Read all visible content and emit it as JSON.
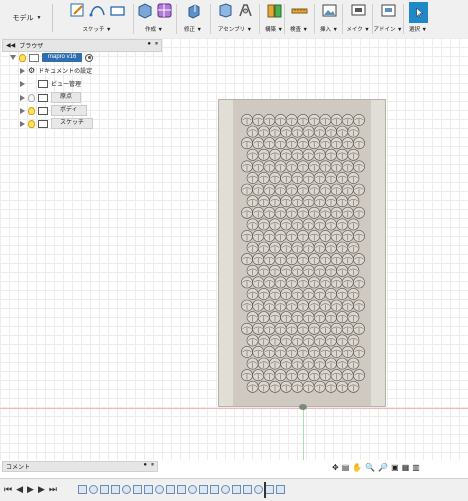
{
  "toolbar": {
    "workspace": "モデル",
    "groups": [
      {
        "label": "スケッチ ▼",
        "icons": [
          "sketch-create-icon",
          "arc-icon",
          "rectangle-icon"
        ]
      },
      {
        "label": "作成 ▼",
        "icons": [
          "box-icon",
          "sphere-mesh-icon"
        ]
      },
      {
        "label": "修正 ▼",
        "icons": [
          "press-pull-icon"
        ]
      },
      {
        "label": "アセンブリ ▼",
        "icons": [
          "new-component-icon",
          "joint-icon"
        ]
      },
      {
        "label": "構築 ▼",
        "icons": [
          "offset-plane-icon"
        ]
      },
      {
        "label": "検査 ▼",
        "icons": [
          "measure-icon"
        ]
      },
      {
        "label": "挿入 ▼",
        "icons": [
          "insert-image-icon"
        ]
      },
      {
        "label": "メイク ▼",
        "icons": [
          "make-3dprint-icon"
        ]
      },
      {
        "label": "アドイン ▼",
        "icons": [
          "addins-icon"
        ]
      },
      {
        "label": "選択 ▼",
        "icons": [
          "select-cursor-icon"
        ]
      }
    ]
  },
  "browser": {
    "title": "ブラウザ",
    "root": "mapro v16",
    "items": [
      {
        "label": "ドキュメントの設定",
        "icon": "gear-icon"
      },
      {
        "label": "ビュー管理",
        "icon": "folder-icon"
      },
      {
        "label": "原点",
        "icon": "folder-icon"
      },
      {
        "label": "ボディ",
        "icon": "folder-icon"
      },
      {
        "label": "スケッチ",
        "icon": "folder-icon"
      }
    ]
  },
  "comment": {
    "label": "コメント"
  },
  "navbar": {
    "icons": [
      "orbit-icon",
      "pan-icon",
      "look-at-icon",
      "zoom-icon",
      "zoom-window-icon",
      "display-settings-icon",
      "grid-icon",
      "viewports-icon"
    ]
  },
  "timeline": {
    "controls": [
      "⏮",
      "◀",
      "▶",
      "▶",
      "⏭"
    ],
    "step_count": 19
  },
  "colors": {
    "selected_tool": "#1e88c8",
    "root_highlight": "#2f6fb0",
    "model_fill": "#cfc9c1"
  }
}
